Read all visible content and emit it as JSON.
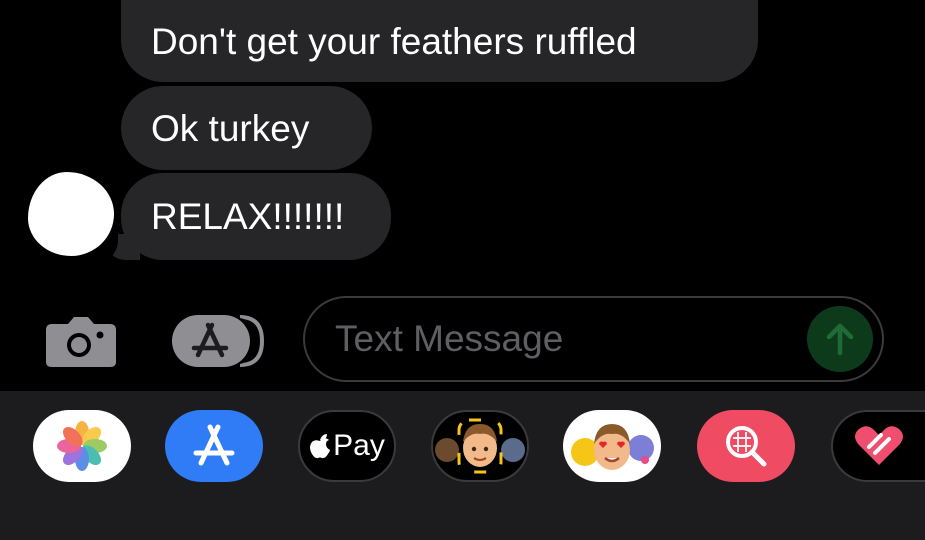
{
  "messages": [
    {
      "text": "Don't get your feathers ruffled"
    },
    {
      "text": "Ok turkey"
    },
    {
      "text": "RELAX!!!!!!!"
    }
  ],
  "composer": {
    "placeholder": "Text Message"
  },
  "app_strip": {
    "apple_pay_label": "Pay",
    "apps": [
      "photos-icon",
      "app-store-icon",
      "apple-pay-icon",
      "memoji-icon",
      "memoji-stickers-icon",
      "image-search-icon",
      "digital-touch-icon"
    ]
  },
  "colors": {
    "bubble": "#262628",
    "send_disabled": "#0e3a1c",
    "app_store": "#2f7cf6",
    "search": "#ef4c63"
  }
}
